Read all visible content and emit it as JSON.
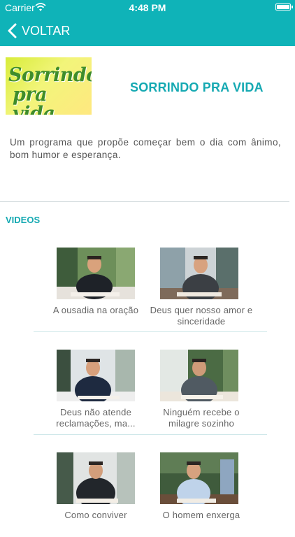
{
  "status_bar": {
    "carrier": "Carrier",
    "time": "4:48 PM"
  },
  "nav": {
    "back_label": "VOLTAR"
  },
  "program": {
    "logo_line1": "Sorrindo",
    "logo_line2": "pra vida",
    "title": "SORRINDO PRA VIDA",
    "description": "Um programa que propõe começar bem o dia com ânimo, bom humor e esperança."
  },
  "videos": {
    "heading": "VIDEOS",
    "items": [
      {
        "title": "A ousadia na oração"
      },
      {
        "title": "Deus quer nosso amor e sinceridade"
      },
      {
        "title": "Deus não atende reclamações, ma..."
      },
      {
        "title": "Ninguém recebe o milagre sozinho"
      },
      {
        "title": "Como conviver"
      },
      {
        "title": "O homem enxerga"
      }
    ]
  },
  "colors": {
    "accent": "#0fb3b8",
    "title_teal": "#15a9b2"
  }
}
